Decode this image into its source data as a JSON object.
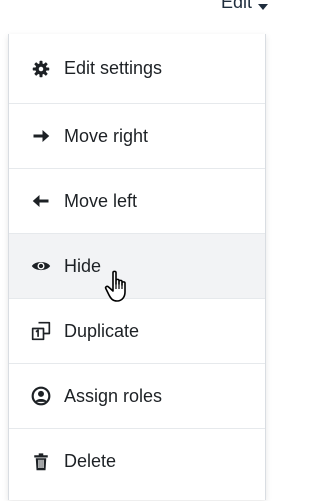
{
  "toggle": {
    "label": "Edit"
  },
  "menu": {
    "items": [
      {
        "label": "Edit settings",
        "icon": "gear-icon"
      },
      {
        "label": "Move right",
        "icon": "arrow-right-icon"
      },
      {
        "label": "Move left",
        "icon": "arrow-left-icon"
      },
      {
        "label": "Hide",
        "icon": "eye-icon",
        "hovered": true
      },
      {
        "label": "Duplicate",
        "icon": "copy-icon"
      },
      {
        "label": "Assign roles",
        "icon": "user-circle-icon"
      },
      {
        "label": "Delete",
        "icon": "trash-icon"
      }
    ]
  },
  "colors": {
    "text": "#1d2125",
    "hover_bg": "#f2f3f5",
    "divider": "#e6e9ec"
  }
}
